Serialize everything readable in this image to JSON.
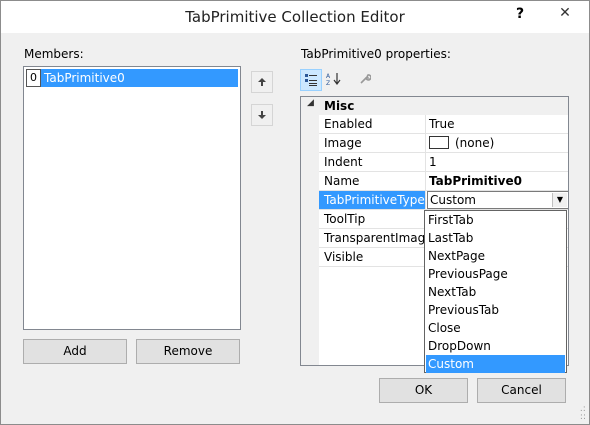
{
  "window": {
    "title": "TabPrimitive Collection Editor",
    "help_label": "?",
    "close_label": "✕"
  },
  "members": {
    "label": "Members:",
    "items": [
      {
        "index": "0",
        "name": "TabPrimitive0"
      }
    ],
    "up_icon": "arrow-up-icon",
    "down_icon": "arrow-down-icon",
    "add_label": "Add",
    "remove_label": "Remove"
  },
  "properties": {
    "label": "TabPrimitive0 properties:",
    "toolbar": {
      "categorized_icon": "categorized-icon",
      "alphabetical_icon": "alphabetical-icon",
      "property_pages_icon": "wrench-icon"
    },
    "category": "Misc",
    "rows": [
      {
        "name": "Enabled",
        "value": "True"
      },
      {
        "name": "Image",
        "value": "(none)"
      },
      {
        "name": "Indent",
        "value": "1"
      },
      {
        "name": "Name",
        "value": "TabPrimitive0"
      },
      {
        "name": "TabPrimitiveType",
        "value": "Custom"
      },
      {
        "name": "ToolTip",
        "value": ""
      },
      {
        "name": "TransparentImageColor",
        "value": ""
      },
      {
        "name": "Visible",
        "value": ""
      }
    ],
    "dropdown_options": [
      "FirstTab",
      "LastTab",
      "NextPage",
      "PreviousPage",
      "NextTab",
      "PreviousTab",
      "Close",
      "DropDown",
      "Custom"
    ],
    "selected_option": "Custom"
  },
  "footer": {
    "ok_label": "OK",
    "cancel_label": "Cancel"
  },
  "colors": {
    "selection": "#3399ff",
    "window_background": "#f0f0f0"
  }
}
